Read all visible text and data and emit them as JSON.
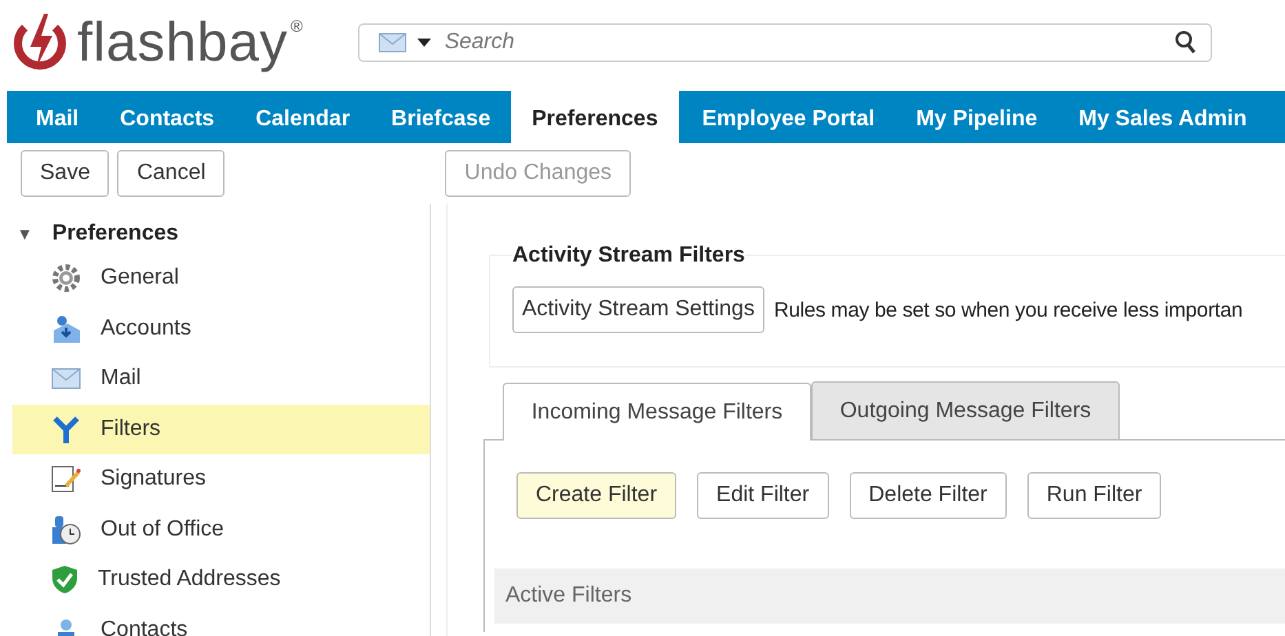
{
  "logo": {
    "text": "flashbay",
    "mark": "®"
  },
  "search": {
    "placeholder": "Search"
  },
  "nav": [
    {
      "label": "Mail",
      "selected": false
    },
    {
      "label": "Contacts",
      "selected": false
    },
    {
      "label": "Calendar",
      "selected": false
    },
    {
      "label": "Briefcase",
      "selected": false
    },
    {
      "label": "Preferences",
      "selected": true
    },
    {
      "label": "Employee Portal",
      "selected": false
    },
    {
      "label": "My Pipeline",
      "selected": false
    },
    {
      "label": "My Sales Admin",
      "selected": false
    }
  ],
  "toolbar": [
    {
      "label": "Save",
      "disabled": false
    },
    {
      "label": "Cancel",
      "disabled": false
    },
    {
      "label": "Undo Changes",
      "disabled": true
    }
  ],
  "sidebar": {
    "title": "Preferences",
    "toggle": "▼",
    "expanded": true,
    "items": [
      {
        "label": "General",
        "kind": "gear",
        "selected": false
      },
      {
        "label": "Accounts",
        "kind": "accounts",
        "selected": false
      },
      {
        "label": "Mail",
        "kind": "mail",
        "selected": false
      },
      {
        "label": "Filters",
        "kind": "filter",
        "selected": true
      },
      {
        "label": "Signatures",
        "kind": "signature",
        "selected": false
      },
      {
        "label": "Out of Office",
        "kind": "clock",
        "selected": false
      },
      {
        "label": "Trusted Addresses",
        "kind": "shield",
        "selected": false
      },
      {
        "label": "Contacts",
        "kind": "contact",
        "selected": false
      }
    ]
  },
  "activity": {
    "legend": "Activity Stream Filters",
    "button": "Activity Stream Settings",
    "text": "Rules may be set so when you receive less importan"
  },
  "tabs": [
    {
      "label": "Incoming Message Filters",
      "selected": true
    },
    {
      "label": "Outgoing Message Filters",
      "selected": false
    }
  ],
  "actions": [
    {
      "label": "Create Filter",
      "highlighted": true
    },
    {
      "label": "Edit Filter",
      "highlighted": false
    },
    {
      "label": "Delete Filter",
      "highlighted": false
    },
    {
      "label": "Run Filter",
      "highlighted": false
    }
  ],
  "active_filters": {
    "title": "Active Filters"
  }
}
